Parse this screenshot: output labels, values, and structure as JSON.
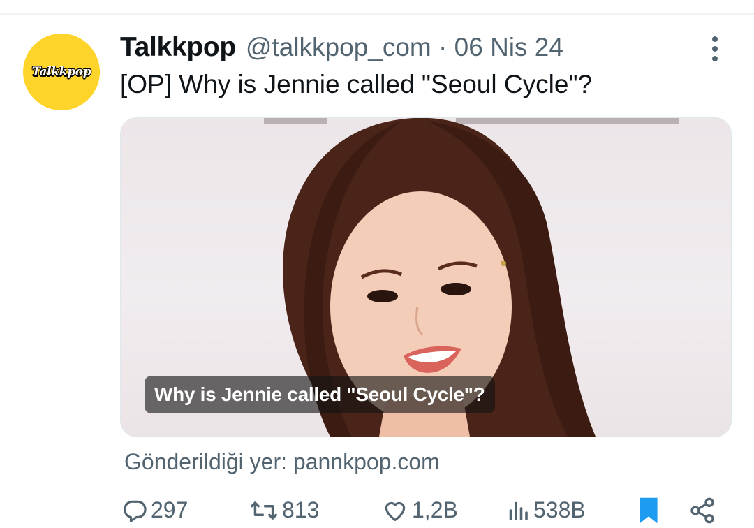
{
  "account": {
    "avatar_text": "Talkkpop",
    "display_name": "Talkkpop",
    "handle_date": "@talkkpop_com · 06 Nis 24"
  },
  "tweet": {
    "text": "[OP] Why is Jennie called \"Seoul Cycle\"?"
  },
  "card": {
    "title": "Why is Jennie called \"Seoul Cycle\"?",
    "source": "Gönderildiği yer: pannkpop.com"
  },
  "actions": {
    "reply": {
      "icon": "reply-icon",
      "count": "297"
    },
    "retweet": {
      "icon": "retweet-icon",
      "count": "813"
    },
    "like": {
      "icon": "heart-icon",
      "count": "1,2B"
    },
    "views": {
      "icon": "views-icon",
      "count": "538B"
    },
    "bookmark": {
      "icon": "bookmark-icon",
      "active": true
    },
    "share": {
      "icon": "share-icon"
    }
  },
  "colors": {
    "avatar_bg": "#fed42a",
    "text_primary": "#0f1419",
    "text_secondary": "#536471",
    "accent": "#1d9bf0"
  }
}
